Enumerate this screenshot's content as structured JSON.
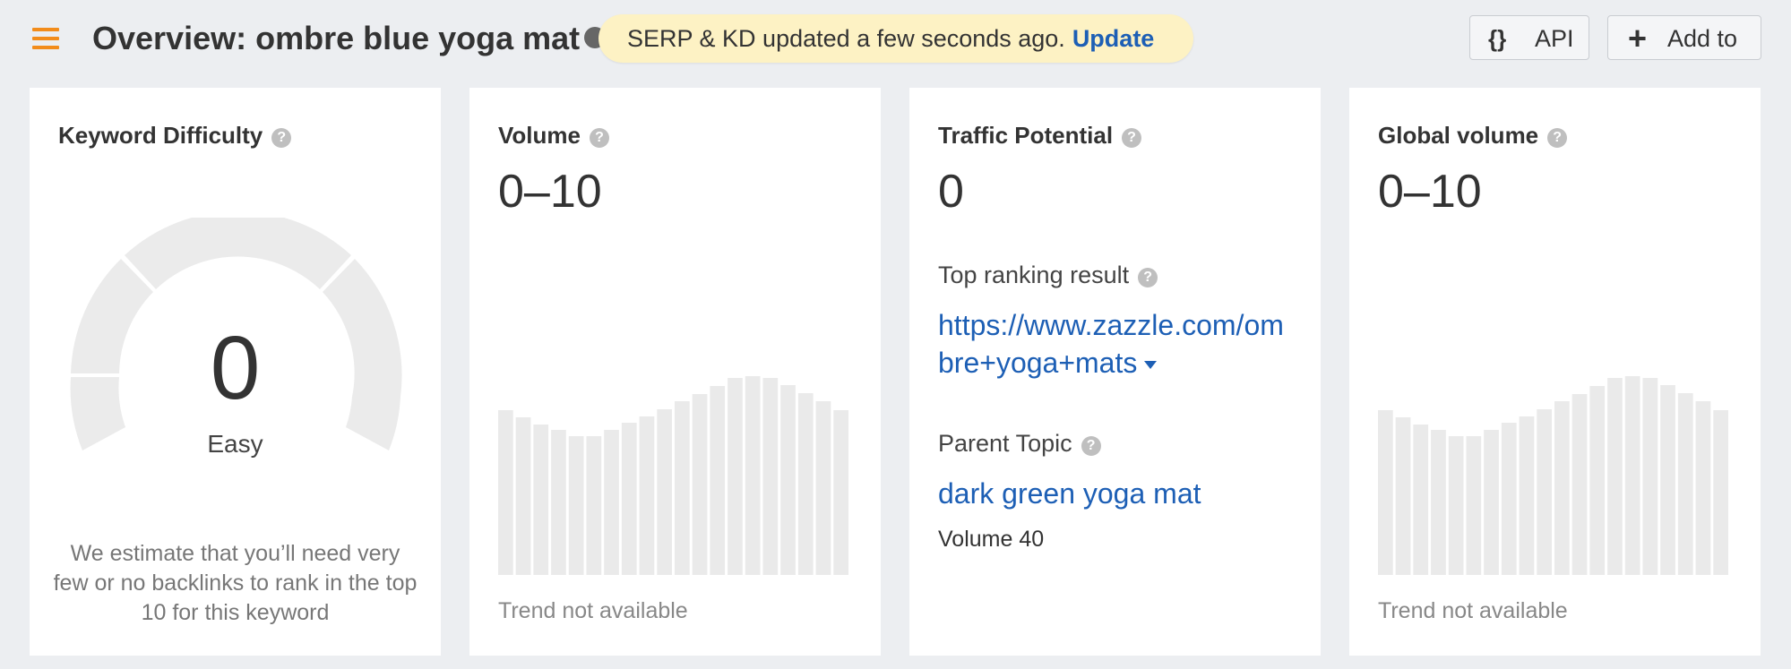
{
  "header": {
    "title": "Overview: ombre blue yoga mat",
    "toast": {
      "message": "SERP & KD updated a few seconds ago.",
      "action": "Update"
    },
    "api_button": {
      "icon": "{}",
      "label": "API"
    },
    "add_button": {
      "icon": "+",
      "label": "Add to"
    }
  },
  "cards": {
    "kd": {
      "title": "Keyword Difficulty",
      "value": "0",
      "label": "Easy",
      "description": "We estimate that you’ll need very few or no backlinks to rank in the top 10 for this keyword"
    },
    "volume": {
      "title": "Volume",
      "value": "0–10",
      "trend_note": "Trend not available"
    },
    "traffic": {
      "title": "Traffic Potential",
      "value": "0",
      "top_result_label": "Top ranking result",
      "top_result_url": "https://www.zazzle.com/ombre+yoga+mats",
      "parent_topic_label": "Parent Topic",
      "parent_topic": "dark green yoga mat",
      "parent_volume": "Volume 40"
    },
    "global": {
      "title": "Global volume",
      "value": "0–10",
      "trend_note": "Trend not available"
    }
  },
  "icons": {
    "help": "?",
    "menu": "hamburger-icon"
  },
  "colors": {
    "accent_orange": "#f28c1b",
    "link_blue": "#1d5fb5",
    "toast_bg": "#fdf2c4",
    "placeholder_bar": "#eaeaea"
  }
}
